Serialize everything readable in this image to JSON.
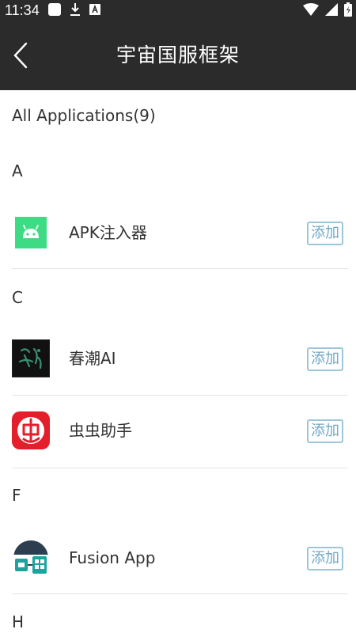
{
  "status_bar": {
    "time": "11:34",
    "left_icons": [
      "notification-icon",
      "download-icon",
      "a-icon"
    ],
    "right_icons": [
      "wifi-icon",
      "signal-icon",
      "battery-icon"
    ]
  },
  "app_bar": {
    "title": "宇宙国服框架",
    "back_icon": "chevron-left-icon"
  },
  "list": {
    "all_label": "All Applications(9)",
    "sections": [
      {
        "letter": "A",
        "apps": [
          {
            "name": "APK注入器",
            "icon": "android-icon",
            "add_label": "添加"
          }
        ]
      },
      {
        "letter": "C",
        "apps": [
          {
            "name": "春潮AI",
            "icon": "calligraphy-icon",
            "add_label": "添加"
          },
          {
            "name": "虫虫助手",
            "icon": "chong-icon",
            "add_label": "添加"
          }
        ]
      },
      {
        "letter": "F",
        "apps": [
          {
            "name": "Fusion App",
            "icon": "fusion-icon",
            "add_label": "添加"
          }
        ]
      },
      {
        "letter": "H",
        "apps": []
      }
    ]
  },
  "colors": {
    "bar_bg": "#2b2b2b",
    "accent": "#6ea9c6"
  }
}
